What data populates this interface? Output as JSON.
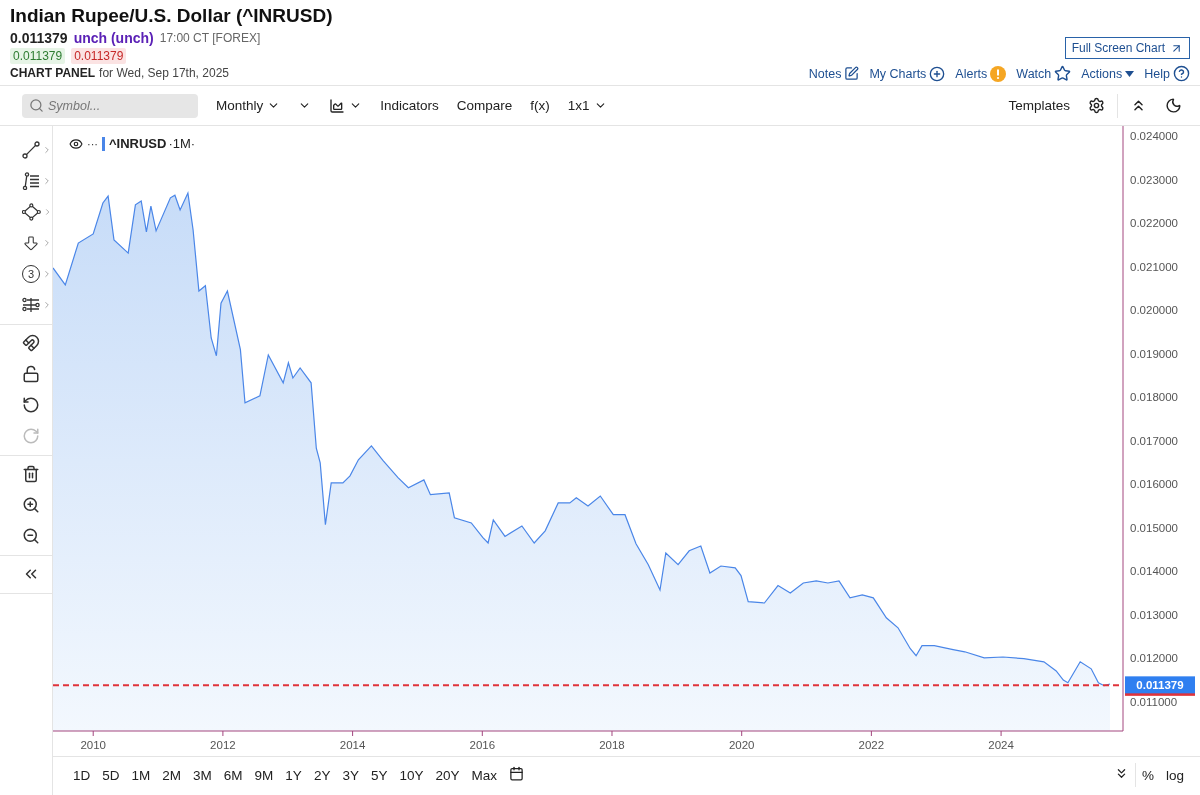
{
  "header": {
    "title": "Indian Rupee/U.S. Dollar (^INRUSD)",
    "last": "0.011379",
    "change": "unch (unch)",
    "time": "17:00 CT [FOREX]",
    "bid": "0.011379",
    "ask": "0.011379",
    "panel_label": "CHART PANEL",
    "panel_date": "for Wed, Sep 17th, 2025"
  },
  "full_screen_button": "Full Screen Chart",
  "links": [
    {
      "kind": "notes",
      "label": "Notes"
    },
    {
      "kind": "add",
      "label": "My Charts"
    },
    {
      "kind": "alert",
      "label": "Alerts"
    },
    {
      "kind": "star",
      "label": "Watch"
    },
    {
      "kind": "menu",
      "label": "Actions"
    },
    {
      "kind": "help",
      "label": "Help"
    }
  ],
  "toolbar": {
    "search": {
      "placeholder": "Symbol..."
    },
    "items": [
      {
        "kind": "dropdown",
        "label": "Monthly"
      },
      {
        "kind": "dropdown"
      },
      {
        "kind": "chart-type"
      },
      {
        "kind": "button",
        "label": "Indicators"
      },
      {
        "kind": "button",
        "label": "Compare"
      },
      {
        "kind": "button",
        "label": "f(x)"
      },
      {
        "kind": "dropdown",
        "label": "1x1"
      }
    ],
    "right": [
      {
        "kind": "button",
        "label": "Templates"
      },
      {
        "kind": "settings"
      },
      {
        "kind": "collapse"
      },
      {
        "kind": "theme"
      }
    ]
  },
  "tools": [
    [
      {
        "kind": "line",
        "submenu": true,
        "disabled": false
      },
      {
        "kind": "fib",
        "submenu": true,
        "disabled": false
      },
      {
        "kind": "shape",
        "submenu": true,
        "disabled": false
      },
      {
        "kind": "arrow",
        "submenu": true,
        "disabled": false
      },
      {
        "kind": "counter",
        "label": "3",
        "submenu": true,
        "disabled": false
      },
      {
        "kind": "measure",
        "submenu": true,
        "disabled": false
      }
    ],
    [
      {
        "kind": "magnet",
        "submenu": false,
        "disabled": false
      },
      {
        "kind": "lock",
        "submenu": false,
        "disabled": false
      },
      {
        "kind": "undo",
        "submenu": false,
        "disabled": false
      },
      {
        "kind": "redo",
        "submenu": false,
        "disabled": true
      }
    ],
    [
      {
        "kind": "trash",
        "submenu": false,
        "disabled": false
      },
      {
        "kind": "zoom-in",
        "submenu": false,
        "disabled": false
      },
      {
        "kind": "zoom-out",
        "submenu": false,
        "disabled": false
      }
    ],
    [
      {
        "kind": "collapse",
        "submenu": false,
        "disabled": false
      }
    ]
  ],
  "chart": {
    "legend": {
      "menu": "···",
      "interval": "·1M·"
    },
    "chart_data": {
      "type": "area",
      "x": [
        2009.38,
        2009.57,
        2009.77,
        2010.0,
        2010.15,
        2010.23,
        2010.32,
        2010.54,
        2010.65,
        2010.74,
        2010.82,
        2010.89,
        2010.97,
        2011.19,
        2011.26,
        2011.34,
        2011.46,
        2011.54,
        2011.63,
        2011.73,
        2011.82,
        2011.9,
        2011.97,
        2012.07,
        2012.27,
        2012.34,
        2012.57,
        2012.7,
        2012.93,
        2013.01,
        2013.08,
        2013.19,
        2013.36,
        2013.44,
        2013.5,
        2013.58,
        2013.67,
        2013.85,
        2013.96,
        2014.09,
        2014.29,
        2014.47,
        2014.7,
        2014.86,
        2015.1,
        2015.2,
        2015.49,
        2015.57,
        2015.83,
        2016.01,
        2016.09,
        2016.17,
        2016.35,
        2016.61,
        2016.8,
        2016.97,
        2017.17,
        2017.35,
        2017.45,
        2017.63,
        2017.82,
        2018.02,
        2018.2,
        2018.37,
        2018.56,
        2018.74,
        2018.83,
        2019.02,
        2019.19,
        2019.37,
        2019.51,
        2019.68,
        2019.9,
        2019.99,
        2020.1,
        2020.35,
        2020.56,
        2020.75,
        2020.95,
        2021.15,
        2021.33,
        2021.5,
        2021.67,
        2021.86,
        2022.03,
        2022.23,
        2022.41,
        2022.6,
        2022.69,
        2022.78,
        2022.97,
        2023.26,
        2023.44,
        2023.74,
        2024.03,
        2024.35,
        2024.66,
        2024.85,
        2024.96,
        2025.03,
        2025.22,
        2025.39,
        2025.5,
        2025.59,
        2025.68
      ],
      "series": [
        {
          "name": "^INRUSD",
          "color": "#4a86e8",
          "values": [
            0.02097,
            0.02058,
            0.02154,
            0.02175,
            0.02246,
            0.02262,
            0.02161,
            0.02131,
            0.02242,
            0.02251,
            0.0218,
            0.02239,
            0.02182,
            0.02258,
            0.02264,
            0.0223,
            0.02269,
            0.02184,
            0.02044,
            0.02056,
            0.01936,
            0.01895,
            0.02016,
            0.02044,
            0.01909,
            0.01787,
            0.01803,
            0.01897,
            0.01833,
            0.01879,
            0.01844,
            0.01867,
            0.01833,
            0.01683,
            0.01649,
            0.01507,
            0.01603,
            0.01603,
            0.01619,
            0.01656,
            0.01688,
            0.01654,
            0.01615,
            0.01592,
            0.0161,
            0.01576,
            0.0158,
            0.01523,
            0.01511,
            0.01477,
            0.01465,
            0.01518,
            0.0148,
            0.01504,
            0.01465,
            0.01493,
            0.01557,
            0.01557,
            0.01569,
            0.0155,
            0.01573,
            0.0153,
            0.0153,
            0.01463,
            0.01415,
            0.01357,
            0.01442,
            0.01415,
            0.01447,
            0.01458,
            0.01396,
            0.01412,
            0.01408,
            0.0139,
            0.0133,
            0.01327,
            0.01367,
            0.0135,
            0.01373,
            0.01378,
            0.01373,
            0.01378,
            0.01339,
            0.01346,
            0.01339,
            0.01293,
            0.0127,
            0.01222,
            0.01206,
            0.01229,
            0.01229,
            0.0122,
            0.01215,
            0.01201,
            0.01203,
            0.01199,
            0.01192,
            0.01171,
            0.0115,
            0.01144,
            0.01192,
            0.01176,
            0.01144,
            0.01137,
            0.01141
          ]
        }
      ],
      "xlim": [
        2009.38,
        2025.88
      ],
      "ylim": [
        0.01033,
        0.02423
      ],
      "xticks": [
        2010,
        2012,
        2014,
        2016,
        2018,
        2020,
        2022,
        2024
      ],
      "yticks": [
        {
          "value": 0.024,
          "label": "0.024000"
        },
        {
          "value": 0.023,
          "label": "0.023000"
        },
        {
          "value": 0.022,
          "label": "0.022000"
        },
        {
          "value": 0.021,
          "label": "0.021000"
        },
        {
          "value": 0.02,
          "label": "0.020000"
        },
        {
          "value": 0.019,
          "label": "0.019000"
        },
        {
          "value": 0.018,
          "label": "0.018000"
        },
        {
          "value": 0.017,
          "label": "0.017000"
        },
        {
          "value": 0.016,
          "label": "0.016000"
        },
        {
          "value": 0.015,
          "label": "0.015000"
        },
        {
          "value": 0.014,
          "label": "0.014000"
        },
        {
          "value": 0.013,
          "label": "0.013000"
        },
        {
          "value": 0.012,
          "label": "0.012000"
        },
        {
          "value": 0.011,
          "label": "0.011000"
        }
      ],
      "ref_lines": [
        {
          "axis": "y",
          "value": 0.011379,
          "label": "0.011379",
          "color": "#e0333a"
        }
      ]
    }
  },
  "timeframes": [
    "1D",
    "5D",
    "1M",
    "2M",
    "3M",
    "6M",
    "9M",
    "1Y",
    "2Y",
    "3Y",
    "5Y",
    "10Y",
    "20Y",
    "Max"
  ],
  "scale_options": [
    "%",
    "log"
  ]
}
